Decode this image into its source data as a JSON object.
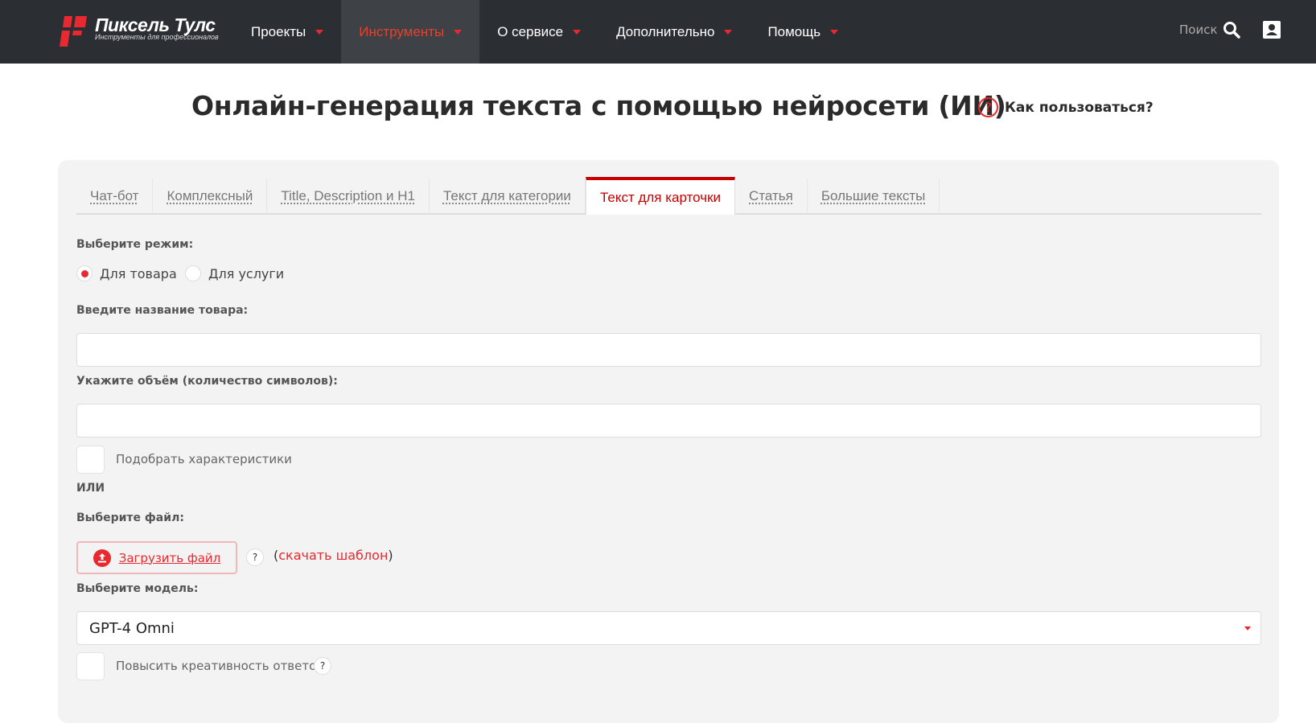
{
  "header": {
    "logo_title": "Пиксель Тулс",
    "logo_subtitle": "Инструменты для профессионалов",
    "nav": [
      {
        "label": "Проекты"
      },
      {
        "label": "Инструменты",
        "active": true
      },
      {
        "label": "О сервисе"
      },
      {
        "label": "Дополнительно"
      },
      {
        "label": "Помощь"
      }
    ],
    "search_label": "Поиск"
  },
  "page": {
    "title": "Онлайн-генерация текста с помощью нейросети (ИИ)",
    "help_link": "Как пользоваться?"
  },
  "tabs": [
    "Чат-бот",
    "Комплексный",
    "Title, Description и H1",
    "Текст для категории",
    "Текст для карточки",
    "Статья",
    "Большие тексты"
  ],
  "active_tab": "Текст для карточки",
  "form": {
    "mode_label": "Выберите режим:",
    "modes": [
      "Для товара",
      "Для услуги"
    ],
    "selected_mode": "Для товара",
    "name_label": "Введите название товара:",
    "name_value": "",
    "volume_label": "Укажите объём (количество символов):",
    "volume_value": "",
    "pick_features": "Подобрать характеристики",
    "or": "ИЛИ",
    "file_label": "Выберите файл:",
    "upload_button": "Загрузить файл",
    "help_q": "?",
    "template_open": "(",
    "template_link": "скачать шаблон",
    "template_close": ")",
    "model_label": "Выберите модель:",
    "model_value": "GPT-4 Omni",
    "creativity": "Повысить креативность ответов"
  },
  "colors": {
    "accent": "#e8292f",
    "header_bg": "#2b2e33",
    "tab_active": "#c40000"
  }
}
